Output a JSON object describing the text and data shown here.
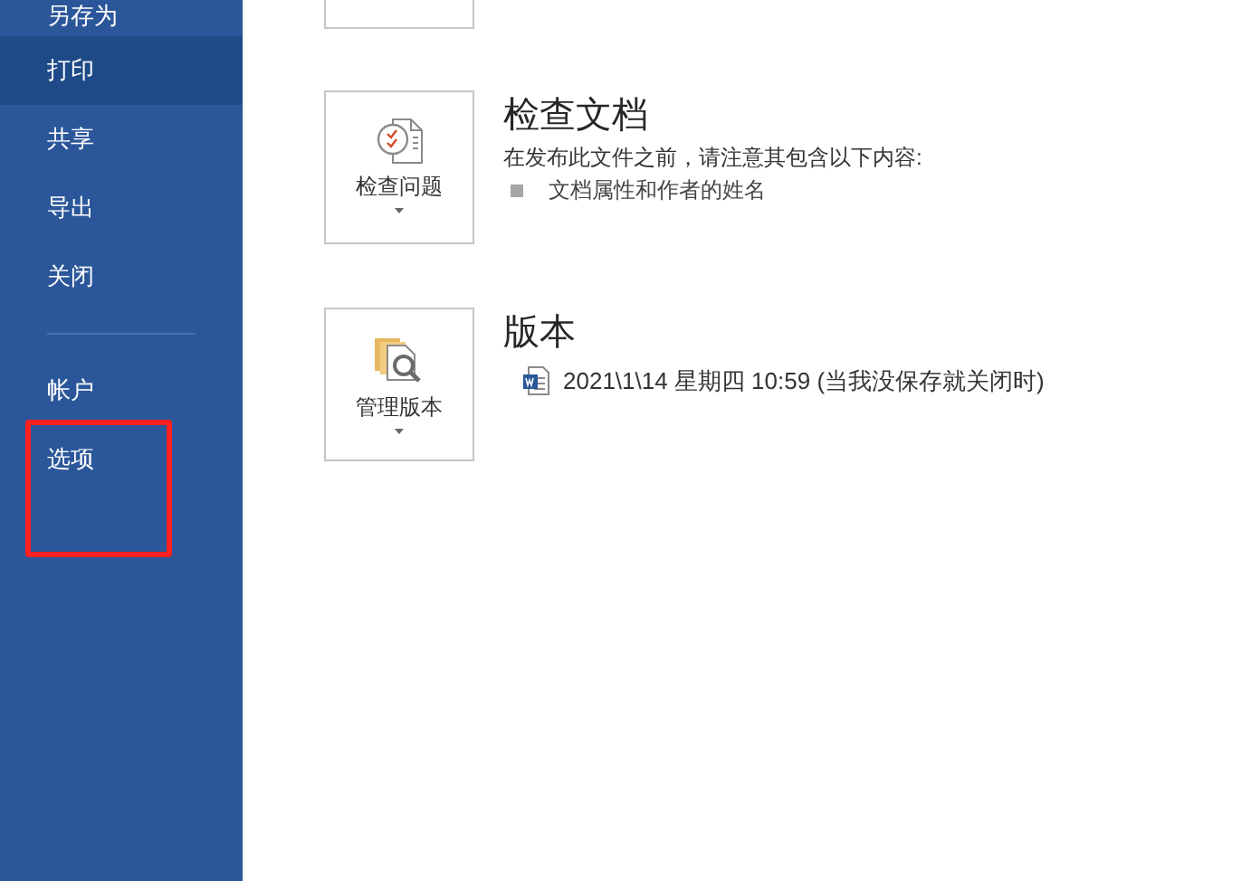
{
  "sidebar": {
    "items": [
      {
        "label": "另存为",
        "selected": false
      },
      {
        "label": "打印",
        "selected": true
      },
      {
        "label": "共享",
        "selected": false
      },
      {
        "label": "导出",
        "selected": false
      },
      {
        "label": "关闭",
        "selected": false
      }
    ],
    "footer_items": [
      {
        "label": "帐户",
        "selected": false,
        "highlighted": false
      },
      {
        "label": "选项",
        "selected": false,
        "highlighted": true
      }
    ]
  },
  "sections": [
    {
      "kind": "inspect",
      "button_label": "检查问题",
      "title": "检查文档",
      "description": "在发布此文件之前，请注意其包含以下内容:",
      "bullets": [
        "文档属性和作者的姓名"
      ]
    },
    {
      "kind": "versions",
      "button_label": "管理版本",
      "title": "版本",
      "versions": [
        "2021\\1\\14 星期四 10:59 (当我没保存就关闭时)"
      ]
    }
  ]
}
